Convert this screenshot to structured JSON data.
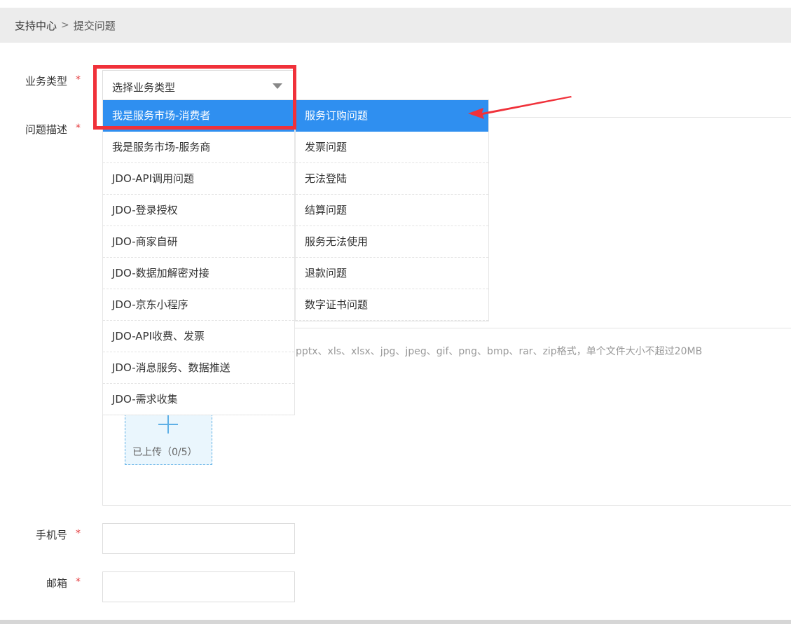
{
  "breadcrumb": {
    "root": "支持中心",
    "separator": ">",
    "current": "提交问题"
  },
  "form": {
    "business_type": {
      "label": "业务类型",
      "required": "*",
      "placeholder": "选择业务类型"
    },
    "description": {
      "label": "问题描述",
      "required": "*"
    },
    "attachment_hint": "pptx、xls、xlsx、jpg、jpeg、gif、png、bmp、rar、zip格式，单个文件大小不超过20MB",
    "upload": {
      "count_label": "已上传（0/5）"
    },
    "phone": {
      "label": "手机号",
      "required": "*"
    },
    "email": {
      "label": "邮箱",
      "required": "*"
    }
  },
  "dropdown": {
    "categories": [
      "我是服务市场-消费者",
      "我是服务市场-服务商",
      "JDO-API调用问题",
      "JDO-登录授权",
      "JDO-商家自研",
      "JDO-数据加解密对接",
      "JDO-京东小程序",
      "JDO-API收费、发票",
      "JDO-消息服务、数据推送",
      "JDO-需求收集"
    ],
    "subcategories": [
      "服务订购问题",
      "发票问题",
      "无法登陆",
      "结算问题",
      "服务无法使用",
      "退款问题",
      "数字证书问题"
    ]
  },
  "colors": {
    "accent": "#2f8ff0",
    "highlight": "#f0313a",
    "required": "#e4393c"
  }
}
